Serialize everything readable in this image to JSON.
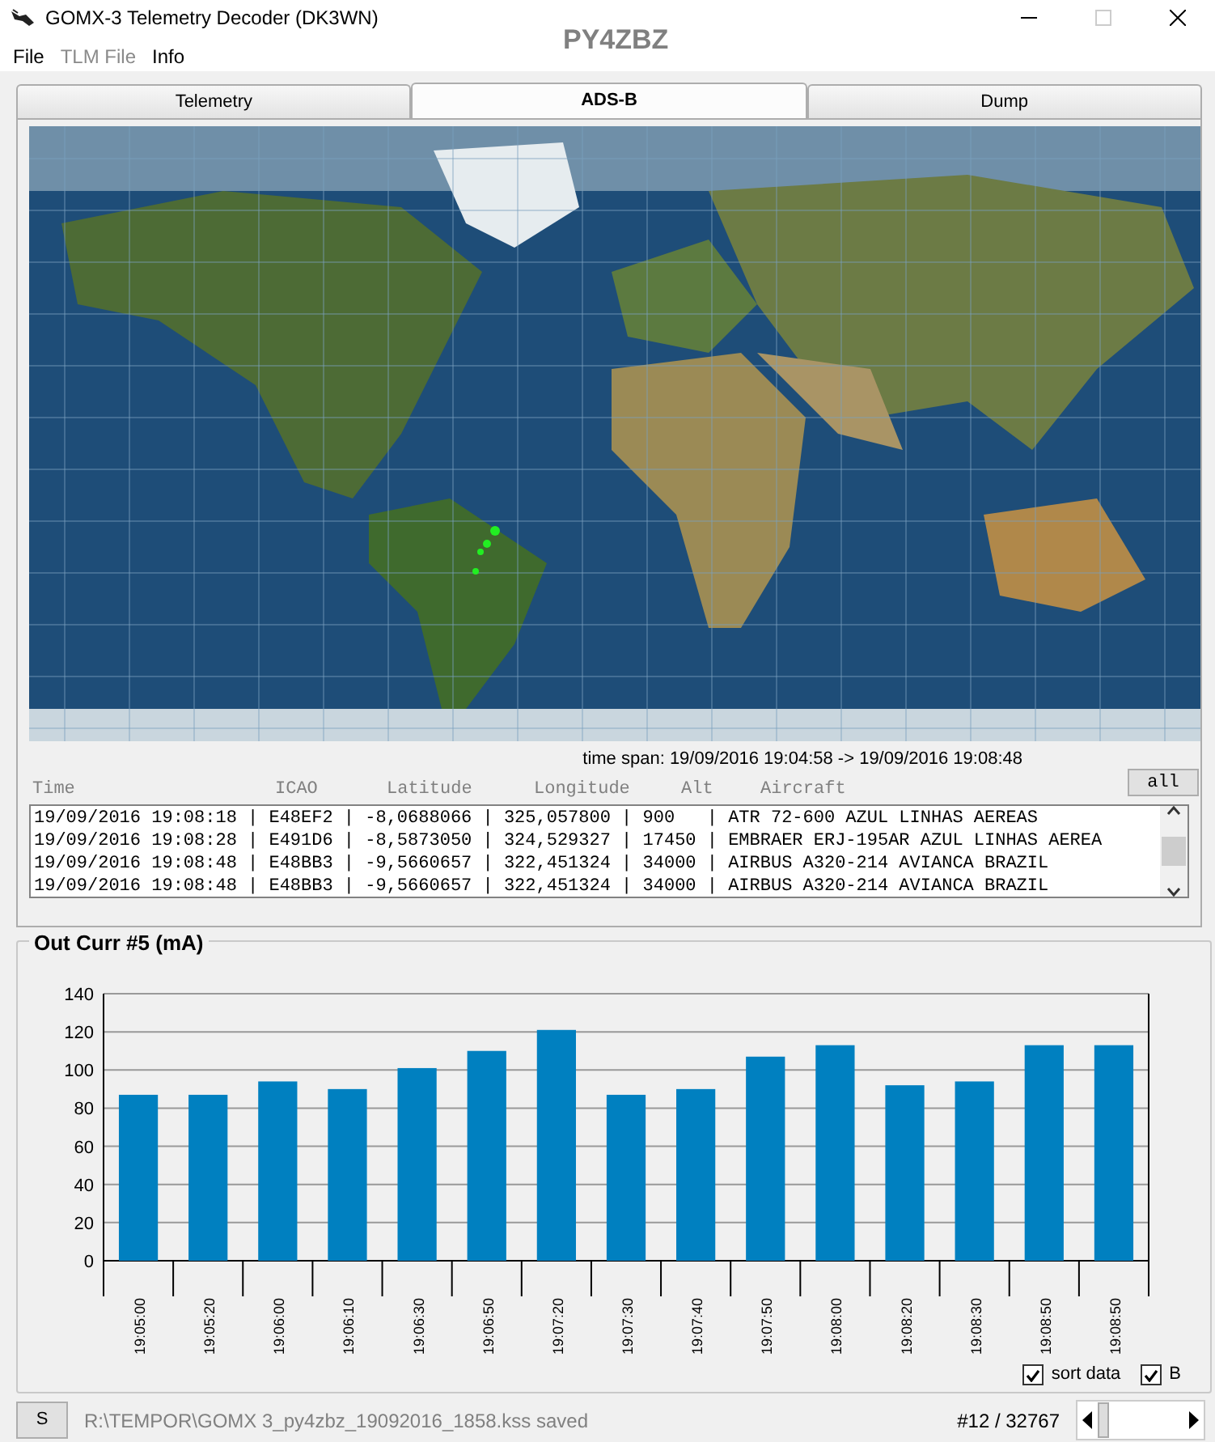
{
  "window": {
    "title": "GOMX-3 Telemetry Decoder (DK3WN)",
    "callsign": "PY4ZBZ",
    "maximize_disabled": true
  },
  "menu": [
    {
      "label": "File",
      "disabled": false
    },
    {
      "label": "TLM File",
      "disabled": true
    },
    {
      "label": "Info",
      "disabled": false
    }
  ],
  "tabs": [
    {
      "label": "Telemetry",
      "selected": false
    },
    {
      "label": "ADS-B",
      "selected": true
    },
    {
      "label": "Dump",
      "selected": false
    }
  ],
  "adsb": {
    "time_span": "time span: 19/09/2016 19:04:58  -> 19/09/2016 19:08:48",
    "all_button": "all",
    "columns": [
      "Time",
      "ICAO",
      "Latitude",
      "Longitude",
      "Alt",
      "Aircraft"
    ],
    "rows": [
      "19/09/2016 19:08:18 | E48EF2 | -8,0688066 | 325,057800 | 900   | ATR 72-600 AZUL LINHAS AEREAS",
      "19/09/2016 19:08:28 | E491D6 | -8,5873050 | 324,529327 | 17450 | EMBRAER ERJ-195AR AZUL LINHAS AEREA",
      "19/09/2016 19:08:48 | E48BB3 | -9,5660657 | 322,451324 | 34000 | AIRBUS A320-214 AVIANCA BRAZIL",
      "19/09/2016 19:08:48 | E48BB3 | -9,5660657 | 322,451324 | 34000 | AIRBUS A320-214 AVIANCA BRAZIL"
    ]
  },
  "chart_panel": {
    "title": "Out Curr #5 (mA)",
    "chart_data": {
      "type": "bar",
      "categories": [
        "19:05:00",
        "19:05:20",
        "19:06:00",
        "19:06:10",
        "19:06:30",
        "19:06:50",
        "19:07:20",
        "19:07:30",
        "19:07:40",
        "19:07:50",
        "19:08:00",
        "19:08:20",
        "19:08:30",
        "19:08:50",
        "19:08:50"
      ],
      "grid": true,
      "series": [
        {
          "color": "#0080c0",
          "values": [
            87,
            87,
            94,
            90,
            101,
            110,
            121,
            87,
            90,
            107,
            113,
            92,
            94,
            113,
            113
          ]
        }
      ],
      "ylim": [
        0,
        140
      ],
      "yticks": [
        0,
        20,
        40,
        60,
        80,
        100,
        120,
        140
      ]
    },
    "options": [
      {
        "label": "sort data",
        "checked": true
      },
      {
        "label": "B",
        "checked": true
      }
    ]
  },
  "status_bar": {
    "button": "S",
    "message": "R:\\TEMPOR\\GOMX 3_py4zbz_19092016_1858.kss saved",
    "record": "#12 / 32767"
  }
}
